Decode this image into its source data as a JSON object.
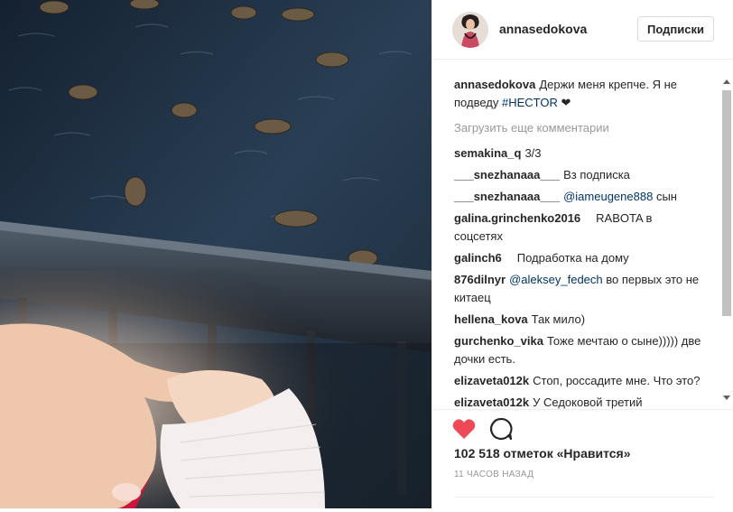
{
  "header": {
    "username": "annasedokova",
    "follow_label": "Подписки"
  },
  "caption": {
    "user": "annasedokova",
    "text": "Держи меня крепче. Я не подведу",
    "hashtag": "#HECTOR",
    "suffix": "❤"
  },
  "load_more": "Загрузить еще комментарии",
  "comments": [
    {
      "user": "semakina_q",
      "text": "3/3"
    },
    {
      "user": "___snezhanaaa___",
      "text": "Вз подписка"
    },
    {
      "user": "___snezhanaaa___",
      "mention": "@iameugene888",
      "text": "сын"
    },
    {
      "user": "galina.grinchenko2016",
      "text": " RABOTA в соцсетях    "
    },
    {
      "user": "galinch6",
      "text": " Подработка на дому    "
    },
    {
      "user": "876dilnyr",
      "mention": "@aleksey_fedech",
      "text": "во первых это не китаец "
    },
    {
      "user": "hellena_kova",
      "text": "Так мило)"
    },
    {
      "user": "gurchenko_vika",
      "text": "Тоже мечтаю о сыне))))) две дочки есть."
    },
    {
      "user": "elizaveta012k",
      "text": "Стоп, россадите мне. Что это?"
    },
    {
      "user": "elizaveta012k",
      "text": "У Седоковой третий"
    }
  ],
  "likes_text": "102 518 отметок «Нравится»",
  "timestamp": "11 ЧАСОВ НАЗАД",
  "colors": {
    "heart": "#ed4956",
    "link": "#003569",
    "muted": "#999999"
  },
  "icons": {
    "like": "heart-icon",
    "comment": "comment-bubble-icon"
  }
}
